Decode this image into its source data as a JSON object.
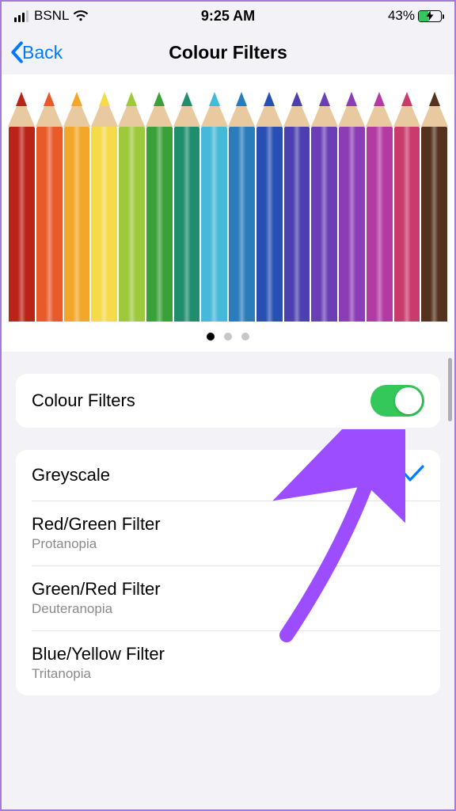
{
  "status": {
    "carrier": "BSNL",
    "time": "9:25 AM",
    "battery_pct": "43%"
  },
  "nav": {
    "back_label": "Back",
    "title": "Colour Filters"
  },
  "toggle_row": {
    "label": "Colour Filters",
    "on": true
  },
  "filters": [
    {
      "title": "Greyscale",
      "subtitle": "",
      "selected": true
    },
    {
      "title": "Red/Green Filter",
      "subtitle": "Protanopia",
      "selected": false
    },
    {
      "title": "Green/Red Filter",
      "subtitle": "Deuteranopia",
      "selected": false
    },
    {
      "title": "Blue/Yellow Filter",
      "subtitle": "Tritanopia",
      "selected": false
    }
  ],
  "pagination": {
    "count": 3,
    "active_index": 0
  },
  "pencil_colors": [
    "#b92318",
    "#e95a29",
    "#f3a72a",
    "#f5da4a",
    "#9ec93c",
    "#3aa03a",
    "#1e8e6d",
    "#45b9d8",
    "#2a7cbb",
    "#2a4fb4",
    "#4b3fb1",
    "#6a3fb5",
    "#8a3db5",
    "#b33aa1",
    "#c93b6d",
    "#54321d"
  ]
}
